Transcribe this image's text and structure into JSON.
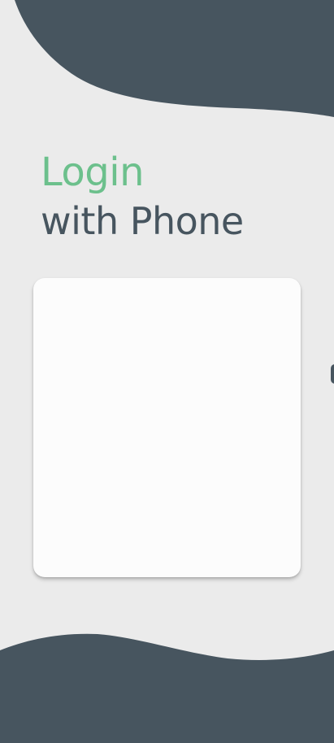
{
  "heading": {
    "line1": "Login",
    "line2": "with Phone"
  },
  "colors": {
    "background": "#ebebeb",
    "accent_green": "#6cc08c",
    "dark_slate": "#47555f",
    "card": "#fcfcfc"
  }
}
